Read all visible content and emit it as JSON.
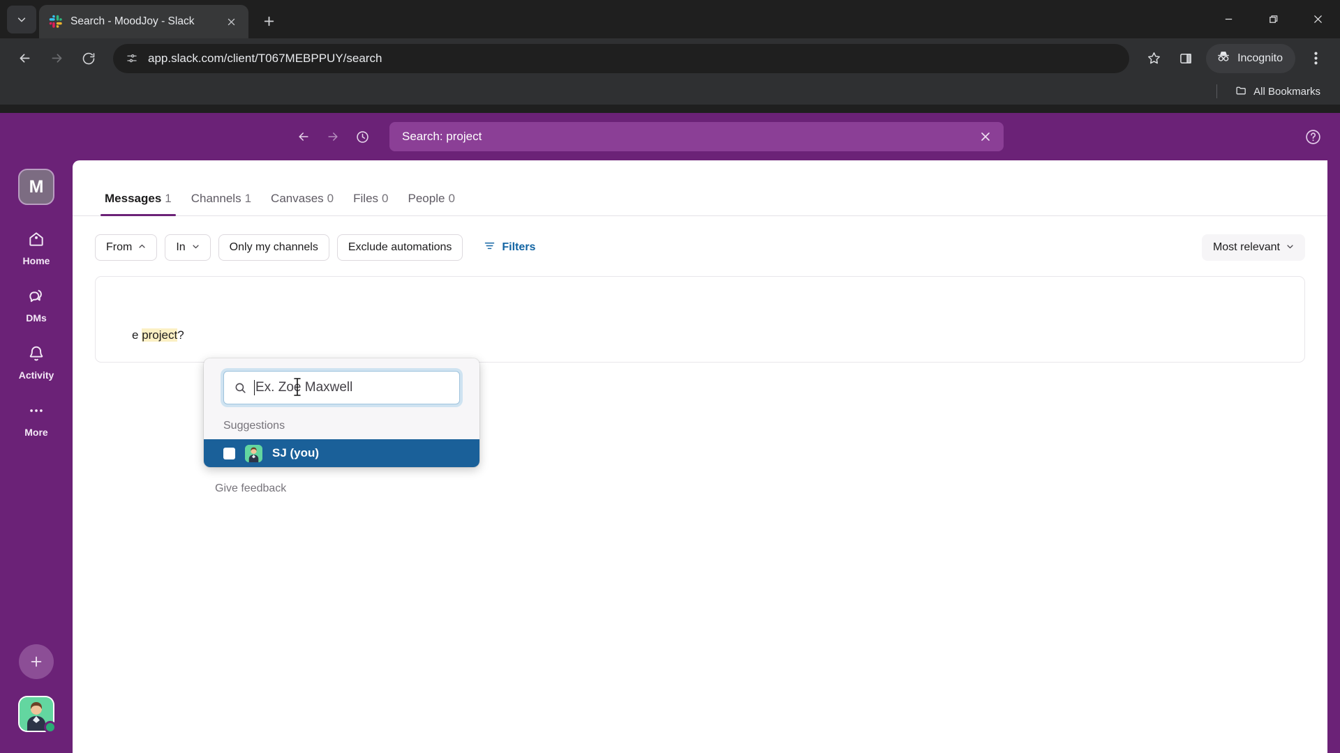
{
  "browser": {
    "tab": {
      "title": "Search - MoodJoy - Slack",
      "favicon": "slack-favicon"
    },
    "tab_list_icon": "chevron-down-icon",
    "new_tab_icon": "plus-icon",
    "close_tab_icon": "close-icon",
    "window": {
      "minimize": "minimize-icon",
      "maximize": "restore-icon",
      "close": "close-icon"
    },
    "toolbar": {
      "back_icon": "back-arrow-icon",
      "forward_icon": "forward-arrow-icon",
      "reload_icon": "reload-icon",
      "site_info_icon": "site-settings-icon",
      "url": "app.slack.com/client/T067MEBPPUY/search",
      "bookmark_icon": "star-icon",
      "sidepanel_icon": "side-panel-icon",
      "incognito_label": "Incognito",
      "incognito_icon": "incognito-icon",
      "menu_icon": "three-dot-menu-icon"
    },
    "bookmarks": {
      "all_bookmarks_label": "All Bookmarks",
      "folder_icon": "folder-icon"
    }
  },
  "slack": {
    "topbar": {
      "back_icon": "back-arrow-icon",
      "forward_icon": "forward-arrow-icon",
      "history_icon": "clock-history-icon",
      "search_value": "Search: project",
      "clear_icon": "close-icon",
      "help_icon": "question-mark-icon"
    },
    "rail": {
      "workspace_initial": "M",
      "items": [
        {
          "label": "Home",
          "icon": "home-icon"
        },
        {
          "label": "DMs",
          "icon": "dms-icon"
        },
        {
          "label": "Activity",
          "icon": "bell-icon"
        },
        {
          "label": "More",
          "icon": "ellipsis-icon"
        }
      ],
      "add_icon": "plus-icon",
      "avatar": "user-avatar"
    },
    "tabs": [
      {
        "label": "Messages",
        "count": "1",
        "active": true
      },
      {
        "label": "Channels",
        "count": "1",
        "active": false
      },
      {
        "label": "Canvases",
        "count": "0",
        "active": false
      },
      {
        "label": "Files",
        "count": "0",
        "active": false
      },
      {
        "label": "People",
        "count": "0",
        "active": false
      }
    ],
    "filters": {
      "from_label": "From",
      "from_chevron": "chevron-up-icon",
      "in_label": "In",
      "in_chevron": "chevron-down-icon",
      "only_my_channels_label": "Only my channels",
      "exclude_automations_label": "Exclude automations",
      "filters_label": "Filters",
      "filters_icon": "filter-icon",
      "sort_label": "Most relevant",
      "sort_chevron": "chevron-down-icon"
    },
    "from_dropdown": {
      "search_placeholder": "Ex. Zoe Maxwell",
      "search_icon": "search-icon",
      "section_label": "Suggestions",
      "options": [
        {
          "label": "SJ (you)",
          "selected": true,
          "avatar": "user-avatar",
          "checkbox": "checkbox-unchecked"
        }
      ]
    },
    "give_feedback_label": "Give feedback",
    "results": [
      {
        "text_before": "e ",
        "highlight": "project",
        "text_after": "?"
      }
    ]
  },
  "colors": {
    "slack_purple": "#6b2277",
    "slack_purple_light": "#8b3f96",
    "accent_blue": "#1264a3",
    "option_selected_blue": "#1a6099",
    "highlight_yellow": "#fbf0c4"
  }
}
